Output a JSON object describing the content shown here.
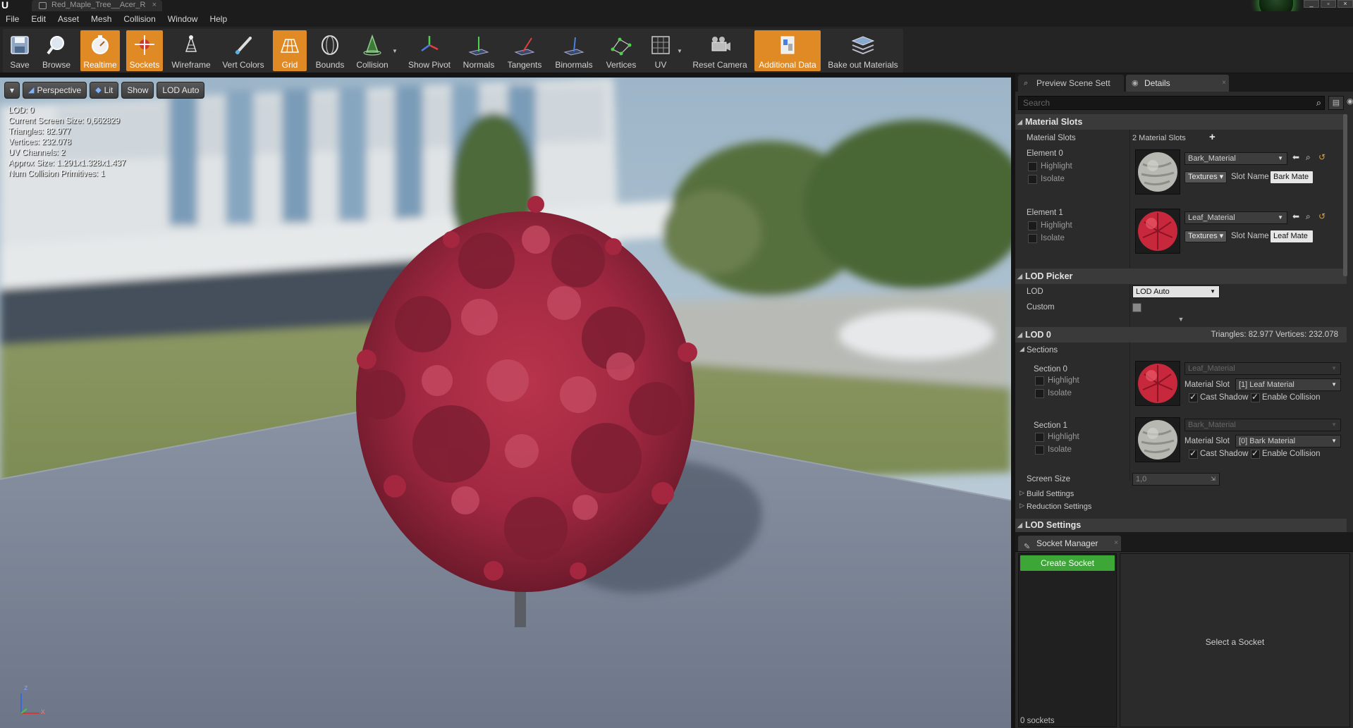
{
  "titlebar": {
    "asset_tab": "Red_Maple_Tree__Acer_R",
    "tab_close": "×",
    "window_controls": [
      "_",
      "▫",
      "×"
    ]
  },
  "menu": [
    "File",
    "Edit",
    "Asset",
    "Mesh",
    "Collision",
    "Window",
    "Help"
  ],
  "toolbar": {
    "buttons": [
      {
        "label": "Save",
        "icon": "save-icon",
        "active": false
      },
      {
        "label": "Browse",
        "icon": "browse-icon",
        "active": false
      },
      {
        "label": "Realtime",
        "icon": "realtime-icon",
        "active": true
      },
      {
        "label": "Sockets",
        "icon": "sockets-icon",
        "active": true
      },
      {
        "label": "Wireframe",
        "icon": "wireframe-icon",
        "active": false
      },
      {
        "label": "Vert Colors",
        "icon": "vert-colors-icon",
        "active": false
      },
      {
        "label": "Grid",
        "icon": "grid-icon",
        "active": true
      },
      {
        "label": "Bounds",
        "icon": "bounds-icon",
        "active": false
      },
      {
        "label": "Collision",
        "icon": "collision-icon",
        "active": false
      },
      {
        "label": "Show Pivot",
        "icon": "pivot-icon",
        "active": false
      },
      {
        "label": "Normals",
        "icon": "normals-icon",
        "active": false
      },
      {
        "label": "Tangents",
        "icon": "tangents-icon",
        "active": false
      },
      {
        "label": "Binormals",
        "icon": "binormals-icon",
        "active": false
      },
      {
        "label": "Vertices",
        "icon": "vertices-icon",
        "active": false
      },
      {
        "label": "UV",
        "icon": "uv-icon",
        "active": false
      },
      {
        "label": "Reset Camera",
        "icon": "camera-icon",
        "active": false
      },
      {
        "label": "Additional Data",
        "icon": "additional-data-icon",
        "active": true
      },
      {
        "label": "Bake out Materials",
        "icon": "bake-icon",
        "active": false
      }
    ]
  },
  "viewport": {
    "menu_btn": "▾",
    "perspective": "Perspective",
    "lit": "Lit",
    "show": "Show",
    "lod": "LOD Auto",
    "stats": [
      "LOD:  0",
      "Current Screen Size:  0,662829",
      "Triangles:  82.977",
      "Vertices:  232.078",
      "UV Channels:  2",
      "Approx Size: 1.291x1.328x1.437",
      "Num Collision Primitives:  1"
    ],
    "axis_z": "z",
    "axis_x": "x"
  },
  "details": {
    "tabs": [
      {
        "label": "Preview Scene Sett",
        "icon": "preview-scene-icon"
      },
      {
        "label": "Details",
        "icon": "details-icon"
      }
    ],
    "search_placeholder": "Search",
    "material_slots": {
      "header": "Material Slots",
      "label": "Material Slots",
      "count": "2 Material Slots",
      "add": "+",
      "elements": [
        {
          "name": "Element 0",
          "material": "Bark_Material",
          "textures": "Textures",
          "slot_name_label": "Slot Name",
          "slot_name": "Bark Mate",
          "highlight": "Highlight",
          "isolate": "Isolate"
        },
        {
          "name": "Element 1",
          "material": "Leaf_Material",
          "textures": "Textures",
          "slot_name_label": "Slot Name",
          "slot_name": "Leaf Mate",
          "highlight": "Highlight",
          "isolate": "Isolate"
        }
      ]
    },
    "lod_picker": {
      "header": "LOD Picker",
      "lod_label": "LOD",
      "lod_value": "LOD Auto",
      "custom_label": "Custom",
      "expand": "▼"
    },
    "lod0": {
      "header": "LOD 0",
      "stats": "Triangles: 82.977   Vertices: 232.078",
      "sections_label": "Sections",
      "sections": [
        {
          "name": "Section 0",
          "material": "Leaf_Material",
          "slot_label": "Material Slot",
          "slot_value": "[1] Leaf Material",
          "cast_shadow": "Cast Shadow",
          "enable_collision": "Enable Collision",
          "highlight": "Highlight",
          "isolate": "Isolate"
        },
        {
          "name": "Section 1",
          "material": "Bark_Material",
          "slot_label": "Material Slot",
          "slot_value": "[0] Bark Material",
          "cast_shadow": "Cast Shadow",
          "enable_collision": "Enable Collision",
          "highlight": "Highlight",
          "isolate": "Isolate"
        }
      ],
      "screen_size_label": "Screen Size",
      "screen_size_value": "1,0",
      "build_settings": "Build Settings",
      "reduction_settings": "Reduction Settings"
    },
    "lod_settings_header": "LOD Settings"
  },
  "socket_manager": {
    "tab": "Socket Manager",
    "create": "Create Socket",
    "count": "0 sockets",
    "empty": "Select a Socket"
  }
}
